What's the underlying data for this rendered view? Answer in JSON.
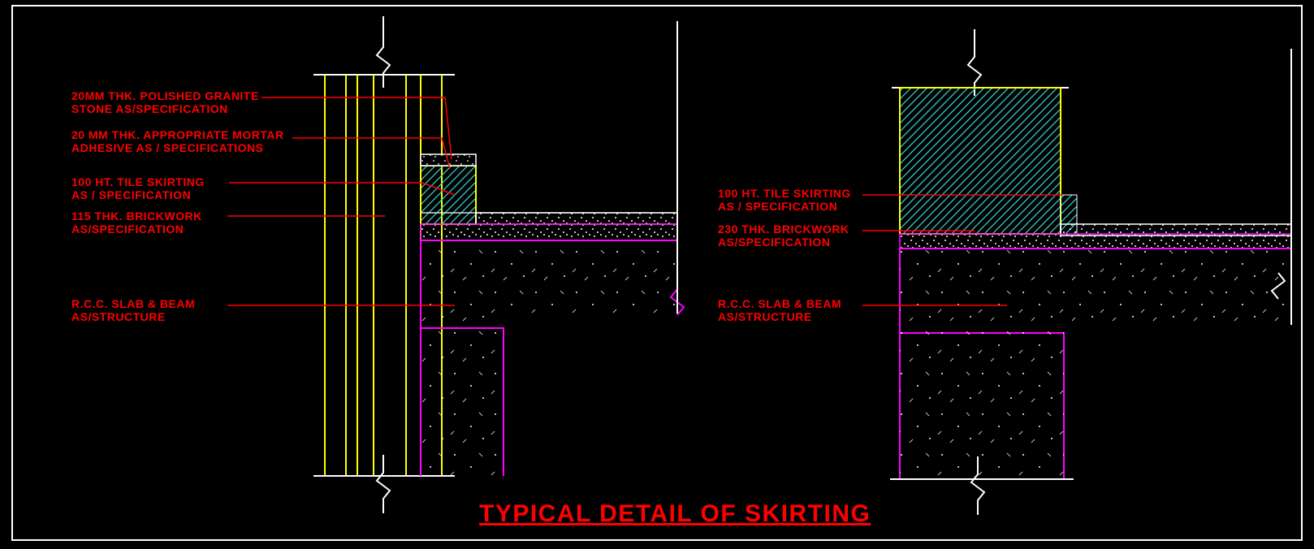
{
  "title": "TYPICAL DETAIL OF SKIRTING",
  "left": {
    "labels": {
      "granite": "20MM THK. POLISHED GRANITE\nSTONE AS/SPECIFICATION",
      "mortar": "20 MM THK. APPROPRIATE MORTAR\nADHESIVE AS / SPECIFICATIONS",
      "skirting": "100 HT. TILE SKIRTING\nAS / SPECIFICATION",
      "brick": "115 THK. BRICKWORK\nAS/SPECIFICATION",
      "slab": "R.C.C. SLAB & BEAM\nAS/STRUCTURE"
    }
  },
  "right": {
    "labels": {
      "skirting": "100 HT. TILE SKIRTING\nAS / SPECIFICATION",
      "brick": "230 THK. BRICKWORK\nAS/SPECIFICATION",
      "slab": "R.C.C. SLAB & BEAM\nAS/STRUCTURE"
    }
  },
  "colors": {
    "red": "#ff0000",
    "yellow": "#ffff00",
    "white": "#ffffff",
    "magenta": "#ff00ff",
    "cyan": "#30d8d8"
  }
}
